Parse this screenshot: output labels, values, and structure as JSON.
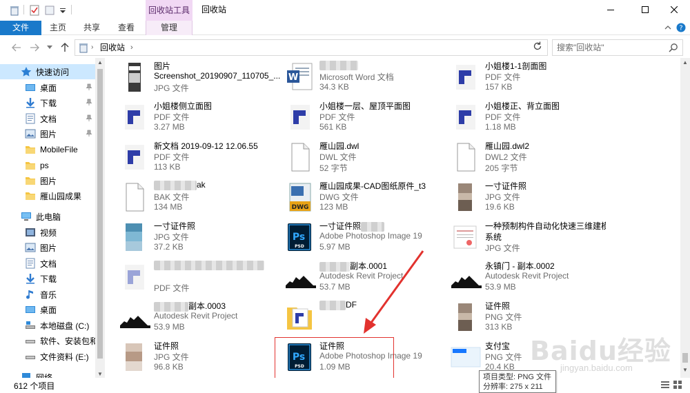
{
  "window": {
    "title": "回收站",
    "context_group": "回收站工具",
    "minimize": "—",
    "maximize": "☐",
    "close": "✕"
  },
  "ribbon": {
    "tabs": [
      "文件",
      "主页",
      "共享",
      "查看",
      "管理"
    ]
  },
  "address": {
    "crumb": "回收站",
    "search_placeholder": "搜索\"回收站\""
  },
  "nav": {
    "quick_access": "快速访问",
    "quick_items": [
      "桌面",
      "下载",
      "文档",
      "图片",
      "MobileFile",
      "ps",
      "图片",
      "雁山园成果"
    ],
    "this_pc": "此电脑",
    "pc_items": [
      "视频",
      "图片",
      "文档",
      "下载",
      "音乐",
      "桌面",
      "本地磁盘 (C:)",
      "软件、安装包和",
      "文件资料 (E:)"
    ],
    "network": "网络"
  },
  "files": [
    {
      "name": "图片",
      "name2": "Screenshot_20190907_110705_...",
      "type": "JPG 文件",
      "size": ""
    },
    {
      "name": "",
      "type": "Microsoft Word 文档",
      "size": "34.3 KB"
    },
    {
      "name": "小姐楼1-1剖面图",
      "type": "PDF 文件",
      "size": "157 KB"
    },
    {
      "name": "小姐楼侧立面图",
      "type": "PDF 文件",
      "size": "3.27 MB"
    },
    {
      "name": "小姐楼一层、屋顶平面图",
      "type": "PDF 文件",
      "size": "561 KB"
    },
    {
      "name": "小姐楼正、背立面图",
      "type": "PDF 文件",
      "size": "1.18 MB"
    },
    {
      "name": "新文档 2019-09-12 12.06.55",
      "type": "PDF 文件",
      "size": "113 KB"
    },
    {
      "name": "雁山园.dwl",
      "type": "DWL 文件",
      "size": "52 字节"
    },
    {
      "name": "雁山园.dwl2",
      "type": "DWL2 文件",
      "size": "205 字节"
    },
    {
      "name": "ak",
      "type": "BAK 文件",
      "size": "134 MB"
    },
    {
      "name": "雁山园成果-CAD图纸原件_t3",
      "type": "DWG 文件",
      "size": "123 MB"
    },
    {
      "name": "一寸证件照",
      "type": "JPG 文件",
      "size": "19.6 KB"
    },
    {
      "name": "一寸证件照",
      "type": "JPG 文件",
      "size": "37.2 KB"
    },
    {
      "name": "一寸证件照",
      "type": "Adobe Photoshop Image 19",
      "size": "5.97 MB"
    },
    {
      "name": "一种预制构件自动化快速三维建模",
      "name2": "系统",
      "type": "JPG 文件",
      "size": ""
    },
    {
      "name": "",
      "type": "PDF 文件",
      "size": ""
    },
    {
      "name": "副本.0001",
      "type": "Autodesk Revit Project",
      "size": "53.7 MB"
    },
    {
      "name": "永镇门 - 副本.0002",
      "type": "Autodesk Revit Project",
      "size": "53.9 MB"
    },
    {
      "name": "副本.0003",
      "type": "Autodesk Revit Project",
      "size": "53.9 MB"
    },
    {
      "name": "DF",
      "type": "",
      "size": ""
    },
    {
      "name": "证件照",
      "type": "PNG 文件",
      "size": "313 KB"
    },
    {
      "name": "证件照",
      "type": "JPG 文件",
      "size": "96.8 KB"
    },
    {
      "name": "证件照",
      "type": "Adobe Photoshop Image 19",
      "size": "1.09 MB"
    },
    {
      "name": "支付宝",
      "type": "PNG 文件",
      "size": "20.4 KB"
    }
  ],
  "status": {
    "count": "612 个项目"
  },
  "tooltip": {
    "line1": "项目类型: PNG 文件",
    "line2": "分辨率: 275 x 211"
  },
  "watermark": {
    "brand": "Baidu经验",
    "url": "jingyan.baidu.com"
  },
  "colors": {
    "file_tab": "#1979ca",
    "context_tab": "#f1d8f4",
    "selection": "#cce8ff",
    "highlight": "#e2322e"
  }
}
